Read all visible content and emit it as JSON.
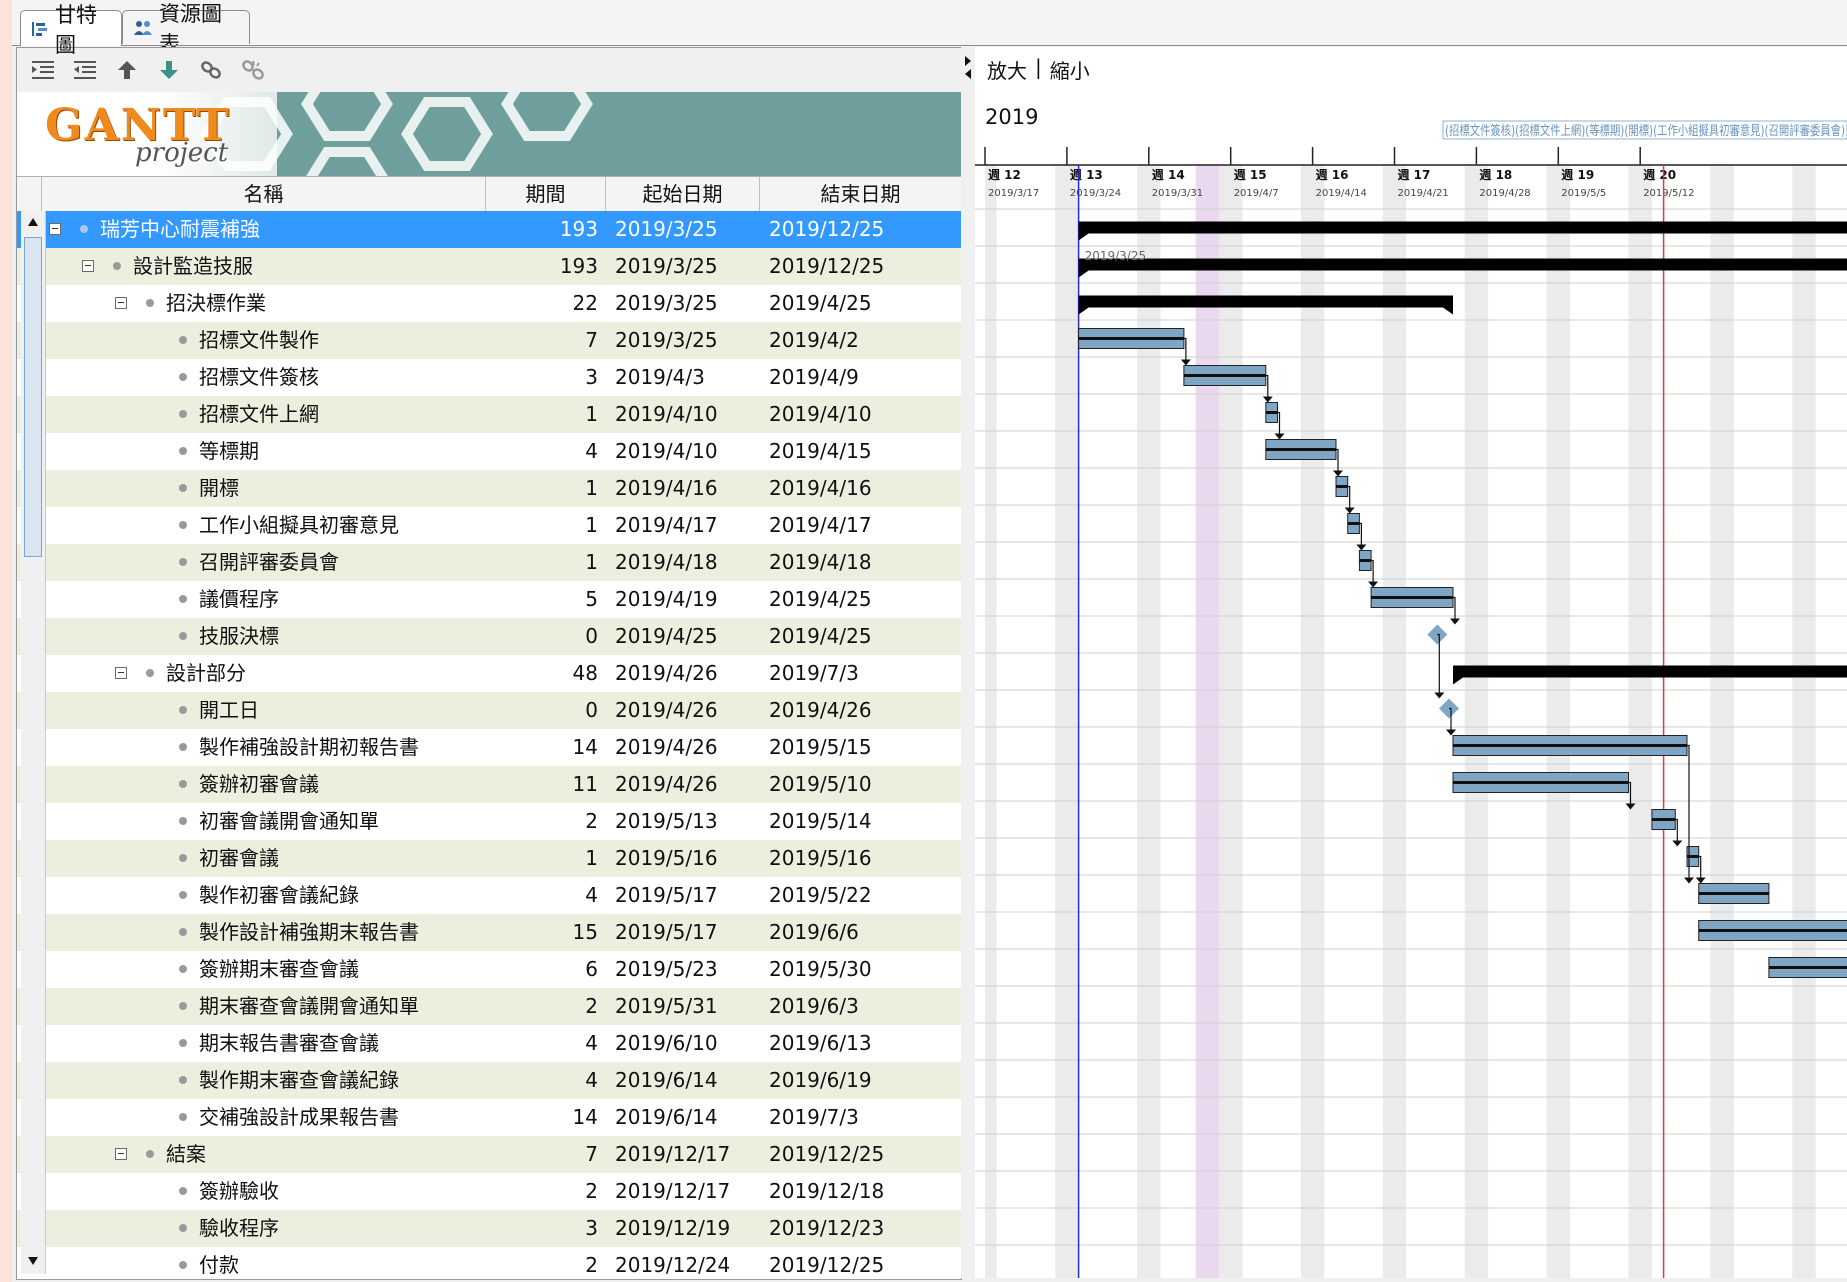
{
  "tabs": [
    {
      "label": "甘特圖",
      "active": true
    },
    {
      "label": "資源圖表",
      "active": false
    }
  ],
  "toolbar_icons": [
    "indent-icon",
    "outdent-icon",
    "move-up-icon",
    "move-down-icon",
    "link-icon",
    "unlink-icon"
  ],
  "banner": {
    "logo_main": "GANTT",
    "logo_sub": "project"
  },
  "columns": {
    "name": "名稱",
    "duration": "期間",
    "start": "起始日期",
    "end": "結束日期"
  },
  "tasks": [
    {
      "name": "瑞芳中心耐震補強",
      "duration": "193",
      "start": "2019/3/25",
      "end": "2019/12/25",
      "level": 0,
      "type": "group",
      "selected": true
    },
    {
      "name": "設計監造技服",
      "duration": "193",
      "start": "2019/3/25",
      "end": "2019/12/25",
      "level": 1,
      "type": "group"
    },
    {
      "name": "招決標作業",
      "duration": "22",
      "start": "2019/3/25",
      "end": "2019/4/25",
      "level": 2,
      "type": "group"
    },
    {
      "name": "招標文件製作",
      "duration": "7",
      "start": "2019/3/25",
      "end": "2019/4/2",
      "level": 3,
      "type": "task"
    },
    {
      "name": "招標文件簽核",
      "duration": "3",
      "start": "2019/4/3",
      "end": "2019/4/9",
      "level": 3,
      "type": "task"
    },
    {
      "name": "招標文件上網",
      "duration": "1",
      "start": "2019/4/10",
      "end": "2019/4/10",
      "level": 3,
      "type": "task"
    },
    {
      "name": "等標期",
      "duration": "4",
      "start": "2019/4/10",
      "end": "2019/4/15",
      "level": 3,
      "type": "task"
    },
    {
      "name": "開標",
      "duration": "1",
      "start": "2019/4/16",
      "end": "2019/4/16",
      "level": 3,
      "type": "task"
    },
    {
      "name": "工作小組擬具初審意見",
      "duration": "1",
      "start": "2019/4/17",
      "end": "2019/4/17",
      "level": 3,
      "type": "task"
    },
    {
      "name": "召開評審委員會",
      "duration": "1",
      "start": "2019/4/18",
      "end": "2019/4/18",
      "level": 3,
      "type": "task"
    },
    {
      "name": "議價程序",
      "duration": "5",
      "start": "2019/4/19",
      "end": "2019/4/25",
      "level": 3,
      "type": "task"
    },
    {
      "name": "技服決標",
      "duration": "0",
      "start": "2019/4/25",
      "end": "2019/4/25",
      "level": 3,
      "type": "milestone"
    },
    {
      "name": "設計部分",
      "duration": "48",
      "start": "2019/4/26",
      "end": "2019/7/3",
      "level": 2,
      "type": "group"
    },
    {
      "name": "開工日",
      "duration": "0",
      "start": "2019/4/26",
      "end": "2019/4/26",
      "level": 3,
      "type": "milestone"
    },
    {
      "name": "製作補強設計期初報告書",
      "duration": "14",
      "start": "2019/4/26",
      "end": "2019/5/15",
      "level": 3,
      "type": "task"
    },
    {
      "name": "簽辦初審會議",
      "duration": "11",
      "start": "2019/4/26",
      "end": "2019/5/10",
      "level": 3,
      "type": "task"
    },
    {
      "name": "初審會議開會通知單",
      "duration": "2",
      "start": "2019/5/13",
      "end": "2019/5/14",
      "level": 3,
      "type": "task"
    },
    {
      "name": "初審會議",
      "duration": "1",
      "start": "2019/5/16",
      "end": "2019/5/16",
      "level": 3,
      "type": "task"
    },
    {
      "name": "製作初審會議紀錄",
      "duration": "4",
      "start": "2019/5/17",
      "end": "2019/5/22",
      "level": 3,
      "type": "task"
    },
    {
      "name": "製作設計補強期末報告書",
      "duration": "15",
      "start": "2019/5/17",
      "end": "2019/6/6",
      "level": 3,
      "type": "task"
    },
    {
      "name": "簽辦期末審查會議",
      "duration": "6",
      "start": "2019/5/23",
      "end": "2019/5/30",
      "level": 3,
      "type": "task"
    },
    {
      "name": "期末審查會議開會通知單",
      "duration": "2",
      "start": "2019/5/31",
      "end": "2019/6/3",
      "level": 3,
      "type": "task"
    },
    {
      "name": "期末報告書審查會議",
      "duration": "4",
      "start": "2019/6/10",
      "end": "2019/6/13",
      "level": 3,
      "type": "task"
    },
    {
      "name": "製作期末審查會議紀錄",
      "duration": "4",
      "start": "2019/6/14",
      "end": "2019/6/19",
      "level": 3,
      "type": "task"
    },
    {
      "name": "交補強設計成果報告書",
      "duration": "14",
      "start": "2019/6/14",
      "end": "2019/7/3",
      "level": 3,
      "type": "task"
    },
    {
      "name": "結案",
      "duration": "7",
      "start": "2019/12/17",
      "end": "2019/12/25",
      "level": 2,
      "type": "group"
    },
    {
      "name": "簽辦驗收",
      "duration": "2",
      "start": "2019/12/17",
      "end": "2019/12/18",
      "level": 3,
      "type": "task"
    },
    {
      "name": "驗收程序",
      "duration": "3",
      "start": "2019/12/19",
      "end": "2019/12/23",
      "level": 3,
      "type": "task"
    },
    {
      "name": "付款",
      "duration": "2",
      "start": "2019/12/24",
      "end": "2019/12/25",
      "level": 3,
      "type": "task"
    }
  ],
  "gantt": {
    "zoom_in": "放大",
    "zoom_sep": "|",
    "zoom_out": "縮小",
    "year": "2019",
    "weeks": [
      {
        "label": "週 12",
        "date": "2019/3/17"
      },
      {
        "label": "週 13",
        "date": "2019/3/24"
      },
      {
        "label": "週 14",
        "date": "2019/3/31"
      },
      {
        "label": "週 15",
        "date": "2019/4/7"
      },
      {
        "label": "週 16",
        "date": "2019/4/14"
      },
      {
        "label": "週 17",
        "date": "2019/4/21"
      },
      {
        "label": "週 18",
        "date": "2019/4/28"
      },
      {
        "label": "週 19",
        "date": "2019/5/5"
      },
      {
        "label": "週 20",
        "date": "2019/5/12"
      }
    ],
    "top_bar_label": "2019/3/25",
    "overflow_caption": "(招標文件簽核)(招標文件上網)(等標期)(開標)(工作小組擬具初審意見)(召開評審委員會)",
    "colors": {
      "task": "#7fa6c4",
      "group": "#000000",
      "weekend": "#ebebeb",
      "holiday": "#ead9ee",
      "today": "#e23a3a",
      "project_start": "#2a2ad6"
    }
  }
}
